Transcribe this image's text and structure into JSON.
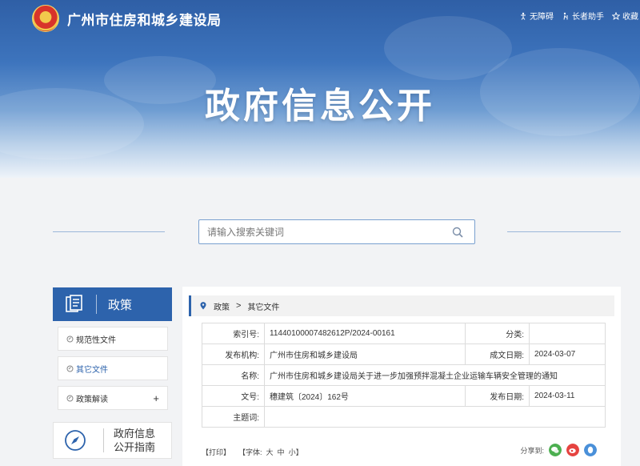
{
  "header": {
    "site_title": "广州市住房和城乡建设局",
    "big_title": "政府信息公开",
    "links": [
      {
        "label": "无障碍",
        "icon": "accessibility-icon"
      },
      {
        "label": "长者助手",
        "icon": "elder-helper-icon"
      },
      {
        "label": "收藏",
        "icon": "star-icon"
      }
    ]
  },
  "search": {
    "placeholder": "请输入搜索关键词"
  },
  "sidebar": {
    "heading": "政策",
    "items": [
      {
        "label": "规范性文件"
      },
      {
        "label": "其它文件"
      },
      {
        "label": "政策解读",
        "expand": "+"
      }
    ],
    "guide": "政府信息公开指南"
  },
  "breadcrumb": {
    "root": "政策",
    "sep": ">",
    "current": "其它文件"
  },
  "info": {
    "index_label": "索引号:",
    "index_value": "11440100007482612P/2024-00161",
    "category_label": "分类:",
    "category_value": "",
    "publisher_label": "发布机构:",
    "publisher_value": "广州市住房和城乡建设局",
    "created_label": "成文日期:",
    "created_value": "2024-03-07",
    "name_label": "名称:",
    "name_value": "广州市住房和城乡建设局关于进一步加强预拌混凝土企业运输车辆安全管理的通知",
    "docno_label": "文号:",
    "docno_value": "穗建筑〔2024〕162号",
    "published_label": "发布日期:",
    "published_value": "2024-03-11",
    "subject_label": "主题词:",
    "subject_value": ""
  },
  "tools": {
    "print": "【打印】",
    "font_label": "【字体:",
    "big": "大",
    "mid": "中",
    "small": "小】"
  },
  "share": {
    "label": "分享到:"
  },
  "colors": {
    "accent": "#2d63ac",
    "wechat": "#4caf50",
    "weibo": "#e64340",
    "qq": "#4a90d9"
  }
}
